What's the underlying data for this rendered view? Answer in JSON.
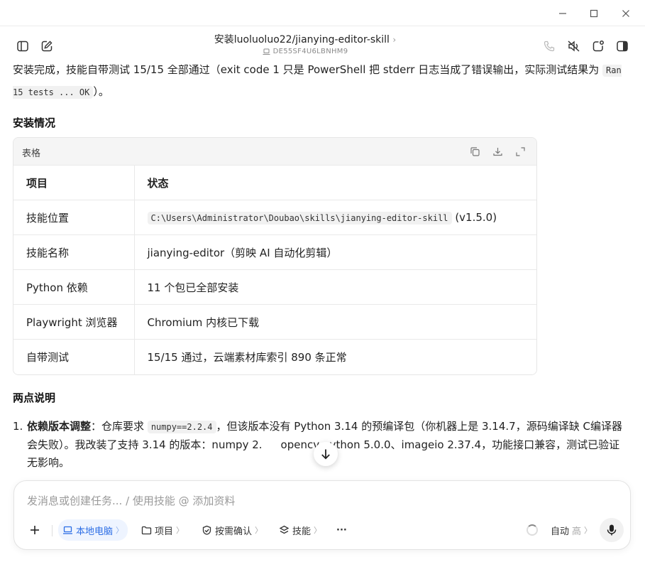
{
  "header": {
    "title": "安装luoluoluo22/jianying-editor-skill",
    "title_chevron": "›",
    "device_id": "DE55SF4U6LBNHM9"
  },
  "content": {
    "intro_text": "安装完成，技能自带测试 15/15 全部通过（exit code 1 只是 PowerShell 把 stderr 日志当成了错误输出，实际测试结果为",
    "intro_code": "Ran 15 tests ... OK",
    "intro_tail": "）。",
    "section1_title": "安装情况",
    "table": {
      "toolbar_label": "表格",
      "headers": [
        "项目",
        "状态"
      ],
      "rows": [
        {
          "item": "技能位置",
          "status_code": "C:\\Users\\Administrator\\Doubao\\skills\\jianying-editor-skill",
          "status_suffix": "(v1.5.0)"
        },
        {
          "item": "技能名称",
          "status": "jianying-editor（剪映 AI 自动化剪辑）"
        },
        {
          "item": "Python 依赖",
          "status": "11 个包已全部安装"
        },
        {
          "item": "Playwright 浏览器",
          "status": "Chromium 内核已下载"
        },
        {
          "item": "自带测试",
          "status": "15/15 通过，云端素材库索引 890 条正常"
        }
      ]
    },
    "section2_title": "两点说明",
    "list": [
      {
        "num": "1.",
        "bold": "依赖版本调整",
        "pre": "：仓库要求",
        "code": "numpy==2.2.4",
        "line1_rest": "，但该版本没有 Python 3.14 的预编译包（你机器上是 3.14.7，源码编译缺 C",
        "line2_start": "编译器会失败）。我改装了支持 3.14 的版本：numpy 2.",
        "line2_end": "opencv-python 5.0.0、imageio 2.37.4，功能接口兼",
        "line3": "容，测试已验证无影响。"
      }
    ]
  },
  "composer": {
    "placeholder": "发消息或创建任务... / 使用技能 @ 添加资料",
    "buttons": {
      "local": "本地电脑",
      "project": "项目",
      "confirm": "按需确认",
      "skills": "技能",
      "more": "···",
      "auto": "自动",
      "level": "高"
    }
  },
  "window": {
    "minimize": "—",
    "maximize": "☐",
    "close": "✕"
  }
}
